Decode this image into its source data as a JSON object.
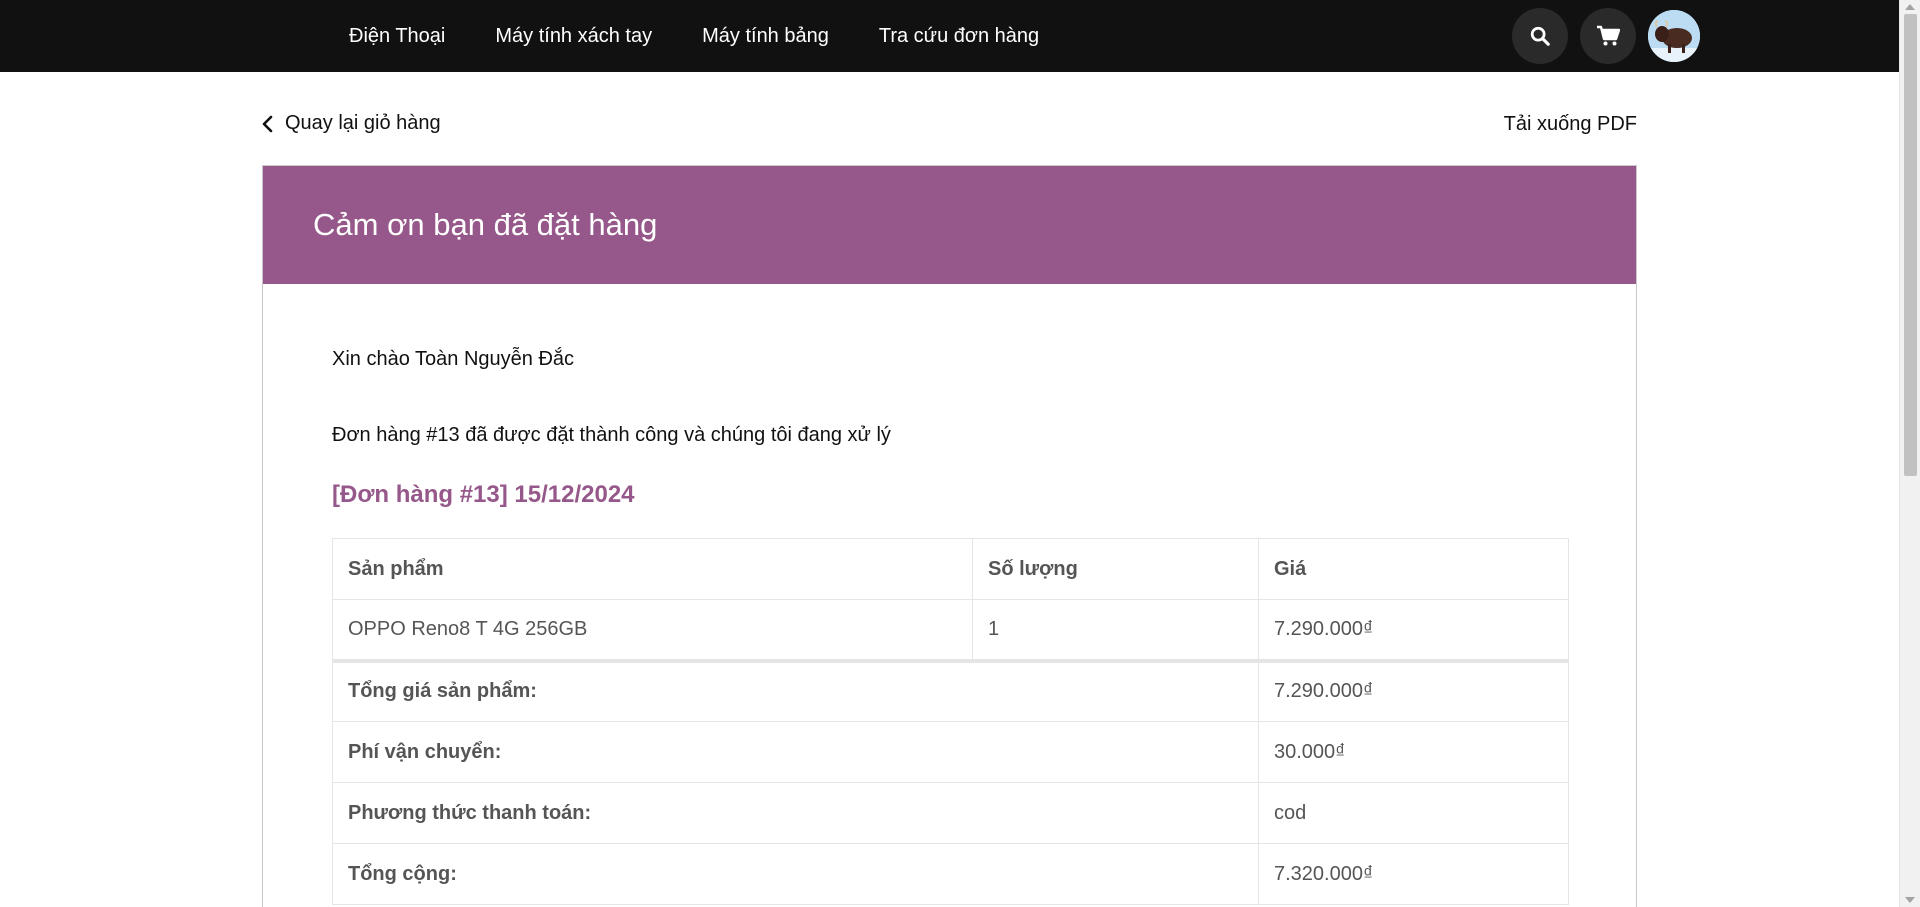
{
  "nav": {
    "links": [
      "Điện Thoại",
      "Máy tính xách tay",
      "Máy tính bảng",
      "Tra cứu đơn hàng"
    ],
    "icons": [
      "search-icon",
      "cart-icon",
      "avatar"
    ]
  },
  "actions": {
    "back_label": "Quay lại giỏ hàng",
    "pdf_label": "Tải xuống PDF"
  },
  "card": {
    "title": "Cảm ơn bạn đã đặt hàng",
    "greeting": "Xin chào Toàn Nguyễn Đắc",
    "message": "Đơn hàng #13 đã được đặt thành công và chúng tôi đang xử lý",
    "order_heading": "[Đơn hàng #13] 15/12/2024"
  },
  "table": {
    "headers": [
      "Sản phẩm",
      "Số lượng",
      "Giá"
    ],
    "rows": [
      {
        "product": "OPPO Reno8 T 4G 256GB",
        "qty": "1",
        "price": "7.290.000₫"
      }
    ],
    "totals": [
      {
        "label": "Tổng giá sản phẩm:",
        "value": "7.290.000₫"
      },
      {
        "label": "Phí vận chuyển:",
        "value": "30.000₫"
      },
      {
        "label": "Phương thức thanh toán:",
        "value": "cod"
      },
      {
        "label": "Tổng cộng:",
        "value": "7.320.000₫"
      }
    ]
  },
  "colors": {
    "accent": "#96588a",
    "topbar": "#111111"
  }
}
